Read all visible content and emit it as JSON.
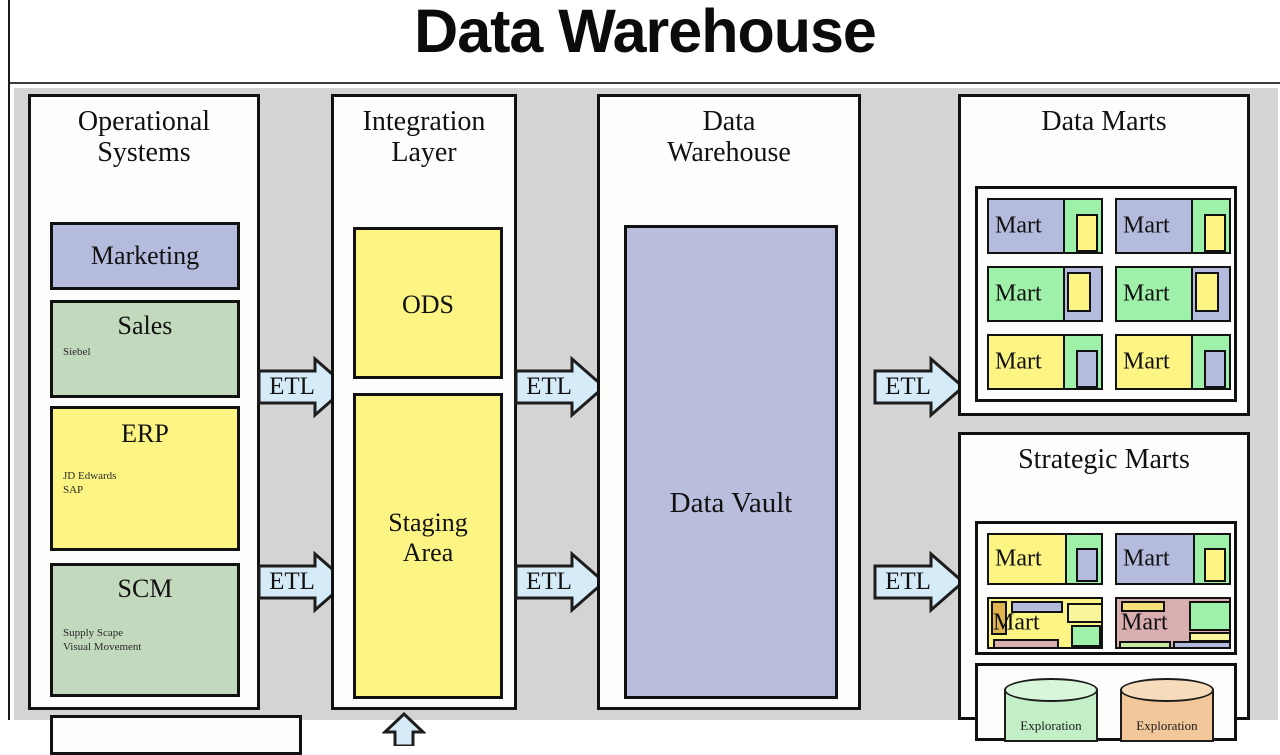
{
  "page": {
    "title": "Data Warehouse"
  },
  "colors": {
    "canvas_gray": "#d4d4d4",
    "panel_white": "#fdfdfb",
    "lavender": "#b5bbdd",
    "green": "#c2d9bd",
    "mint": "#9ff0a8",
    "yellow": "#fcf584",
    "pale_yellow": "#f8f59a",
    "dwh_blue": "#b9bedd",
    "etl_blue": "#d6ebf8",
    "orange": "#f2c89a",
    "rose": "#d9aeae",
    "tan": "#e0b44e",
    "border": "#111111"
  },
  "columns": [
    {
      "id": "operational-systems",
      "title": "Operational\nSystems",
      "title_lines": [
        "Operational",
        "Systems"
      ],
      "boxes": [
        {
          "name": "Marketing",
          "sub": [],
          "color": "#b5bbdd"
        },
        {
          "name": "Sales",
          "sub": [
            "Siebel"
          ],
          "color": "#c2d9bd"
        },
        {
          "name": "ERP",
          "sub": [
            "JD Edwards",
            "SAP"
          ],
          "color": "#fcf584"
        },
        {
          "name": "SCM",
          "sub": [
            "Supply Scape",
            "Visual Movement"
          ],
          "color": "#c2d9bd"
        }
      ]
    },
    {
      "id": "integration-layer",
      "title_lines": [
        "Integration",
        "Layer"
      ],
      "boxes": [
        {
          "name": "ODS",
          "sub": [],
          "color": "#fcf584"
        },
        {
          "name": "Staging Area",
          "name_lines": [
            "Staging",
            "Area"
          ],
          "sub": [],
          "color": "#fcf584"
        }
      ]
    },
    {
      "id": "data-warehouse",
      "title_lines": [
        "Data",
        "Warehouse"
      ],
      "boxes": [
        {
          "name": "Data Vault",
          "sub": [],
          "color": "#b9bedd"
        }
      ]
    }
  ],
  "right_panels": [
    {
      "id": "data-marts",
      "title": "Data Marts",
      "marts": [
        {
          "label": "Mart",
          "main": "#b5bbdd",
          "side_a": "#9ff0a8",
          "side_b": "#fcf584"
        },
        {
          "label": "Mart",
          "main": "#b5bbdd",
          "side_a": "#9ff0a8",
          "side_b": "#fcf584"
        },
        {
          "label": "Mart",
          "main": "#9ff0a8",
          "side_a": "#fcf584",
          "side_b": "#b5bbdd"
        },
        {
          "label": "Mart",
          "main": "#9ff0a8",
          "side_a": "#fcf584",
          "side_b": "#b5bbdd"
        },
        {
          "label": "Mart",
          "main": "#fcf584",
          "side_a": "#9ff0a8",
          "side_b": "#b5bbdd"
        },
        {
          "label": "Mart",
          "main": "#fcf584",
          "side_a": "#9ff0a8",
          "side_b": "#b5bbdd"
        }
      ]
    },
    {
      "id": "strategic-marts",
      "title": "Strategic Marts",
      "marts": [
        {
          "label": "Mart",
          "main": "#fcf584",
          "side_a": "#9ff0a8",
          "side_b": "#b5bbdd"
        },
        {
          "label": "Mart",
          "main": "#b5bbdd",
          "side_a": "#9ff0a8",
          "side_b": "#fcf584"
        },
        {
          "label": "Mart",
          "main": "#fcf584",
          "side_a": "#e0b44e",
          "side_b": "#b5bbdd"
        },
        {
          "label": "Mart",
          "main": "#d9aeae",
          "side_a": "#f5e07a",
          "side_b": "#9ff0a8"
        }
      ],
      "cylinders": [
        {
          "label": "Exploration",
          "color": "#c2efc6"
        },
        {
          "label": "Exploration",
          "color": "#f2c89a"
        }
      ]
    }
  ],
  "arrows": [
    {
      "id": "etl-ops-to-integration-top",
      "label": "ETL"
    },
    {
      "id": "etl-ops-to-integration-bottom",
      "label": "ETL"
    },
    {
      "id": "etl-integration-to-dwh-top",
      "label": "ETL"
    },
    {
      "id": "etl-integration-to-dwh-bottom",
      "label": "ETL"
    },
    {
      "id": "etl-dwh-to-marts-top",
      "label": "ETL"
    },
    {
      "id": "etl-dwh-to-marts-bottom",
      "label": "ETL"
    }
  ]
}
